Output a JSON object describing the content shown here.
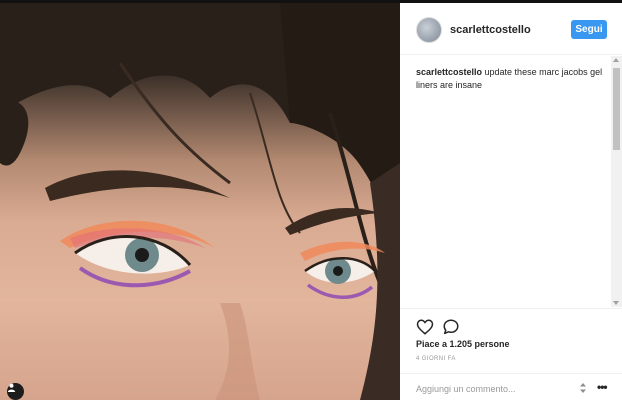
{
  "post": {
    "username": "scarlettcostello",
    "follow_label": "Segui",
    "caption_user": "scarlettcostello",
    "caption_text": " update these marc jacobs gel liners are insane",
    "likes_text": "Piace a 1.205 persone",
    "time_text": "4 GIORNI FA",
    "comment_placeholder": "Aggiungi un commento...",
    "more_label": "•••"
  },
  "icons": {
    "like": "heart-icon",
    "comment": "speech-bubble-icon",
    "tag": "user-tag-icon",
    "sort": "up-down-arrows-icon",
    "more": "ellipsis-icon"
  },
  "colors": {
    "accent": "#3897f0",
    "text": "#262626",
    "muted": "#999999"
  }
}
